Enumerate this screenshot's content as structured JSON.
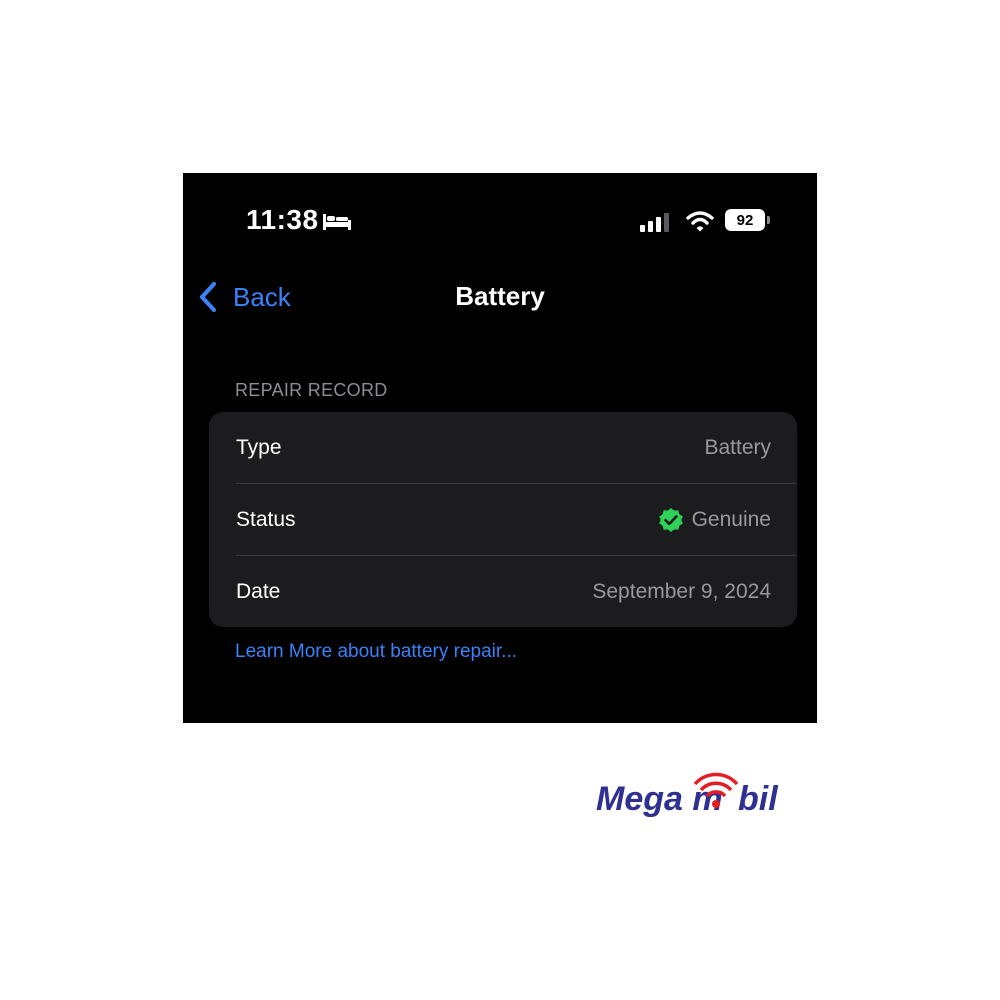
{
  "status_bar": {
    "time": "11:38",
    "battery_level": "92",
    "icons": [
      "bed-icon",
      "cellular-signal-icon",
      "wifi-icon",
      "battery-icon"
    ]
  },
  "nav": {
    "back_label": "Back",
    "title": "Battery"
  },
  "section": {
    "header": "REPAIR RECORD",
    "rows": [
      {
        "label": "Type",
        "value": "Battery"
      },
      {
        "label": "Status",
        "value": "Genuine",
        "icon": "verified-check-icon"
      },
      {
        "label": "Date",
        "value": "September 9, 2024"
      }
    ]
  },
  "learn_more": "Learn More about battery repair...",
  "watermark": {
    "text": "Mega mobil"
  },
  "colors": {
    "accent_blue": "#3a82f7",
    "background": "#000000",
    "card": "#1c1c1e",
    "verified_green": "#30d158",
    "logo_blue": "#2e3192",
    "logo_red": "#e31e24"
  }
}
